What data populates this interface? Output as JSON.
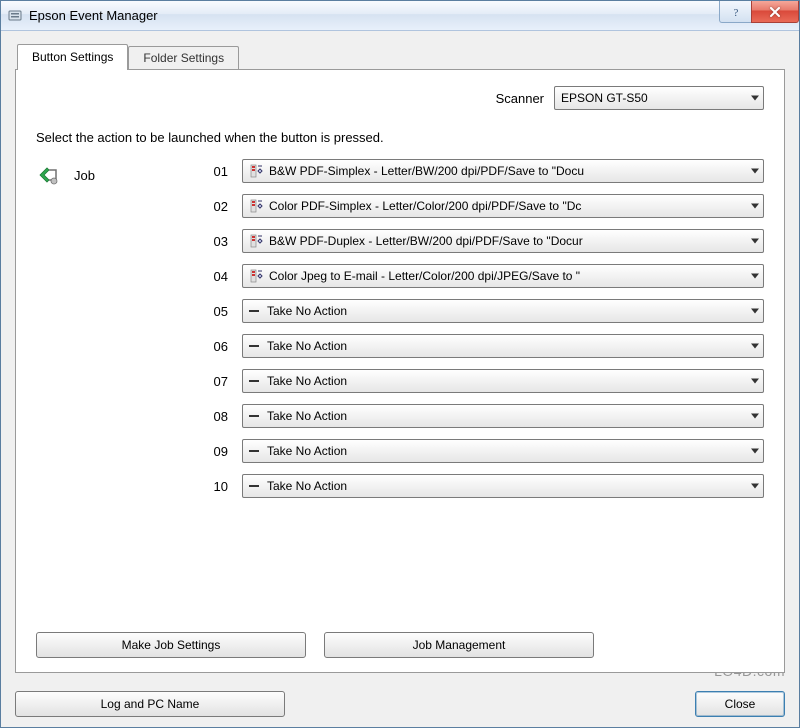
{
  "window": {
    "title": "Epson Event Manager"
  },
  "tabs": {
    "active": "Button Settings",
    "inactive": "Folder Settings"
  },
  "scanner": {
    "label": "Scanner",
    "value": "EPSON GT-S50"
  },
  "instruction": "Select the action to be launched when the button is pressed.",
  "job": {
    "label": "Job",
    "rows": [
      {
        "num": "01",
        "type": "preset",
        "value": "B&W PDF-Simplex - Letter/BW/200 dpi/PDF/Save to \"Docu"
      },
      {
        "num": "02",
        "type": "preset",
        "value": "Color PDF-Simplex - Letter/Color/200 dpi/PDF/Save to \"Dc"
      },
      {
        "num": "03",
        "type": "preset",
        "value": "B&W PDF-Duplex - Letter/BW/200 dpi/PDF/Save to \"Docur"
      },
      {
        "num": "04",
        "type": "preset",
        "value": "Color Jpeg to E-mail - Letter/Color/200 dpi/JPEG/Save to \""
      },
      {
        "num": "05",
        "type": "none",
        "value": "Take No Action"
      },
      {
        "num": "06",
        "type": "none",
        "value": "Take No Action"
      },
      {
        "num": "07",
        "type": "none",
        "value": "Take No Action"
      },
      {
        "num": "08",
        "type": "none",
        "value": "Take No Action"
      },
      {
        "num": "09",
        "type": "none",
        "value": "Take No Action"
      },
      {
        "num": "10",
        "type": "none",
        "value": "Take No Action"
      }
    ]
  },
  "buttons": {
    "make_job_settings": "Make Job Settings",
    "job_management": "Job Management",
    "log_pc_name": "Log and PC Name",
    "close": "Close"
  },
  "watermark": "LO4D.com"
}
